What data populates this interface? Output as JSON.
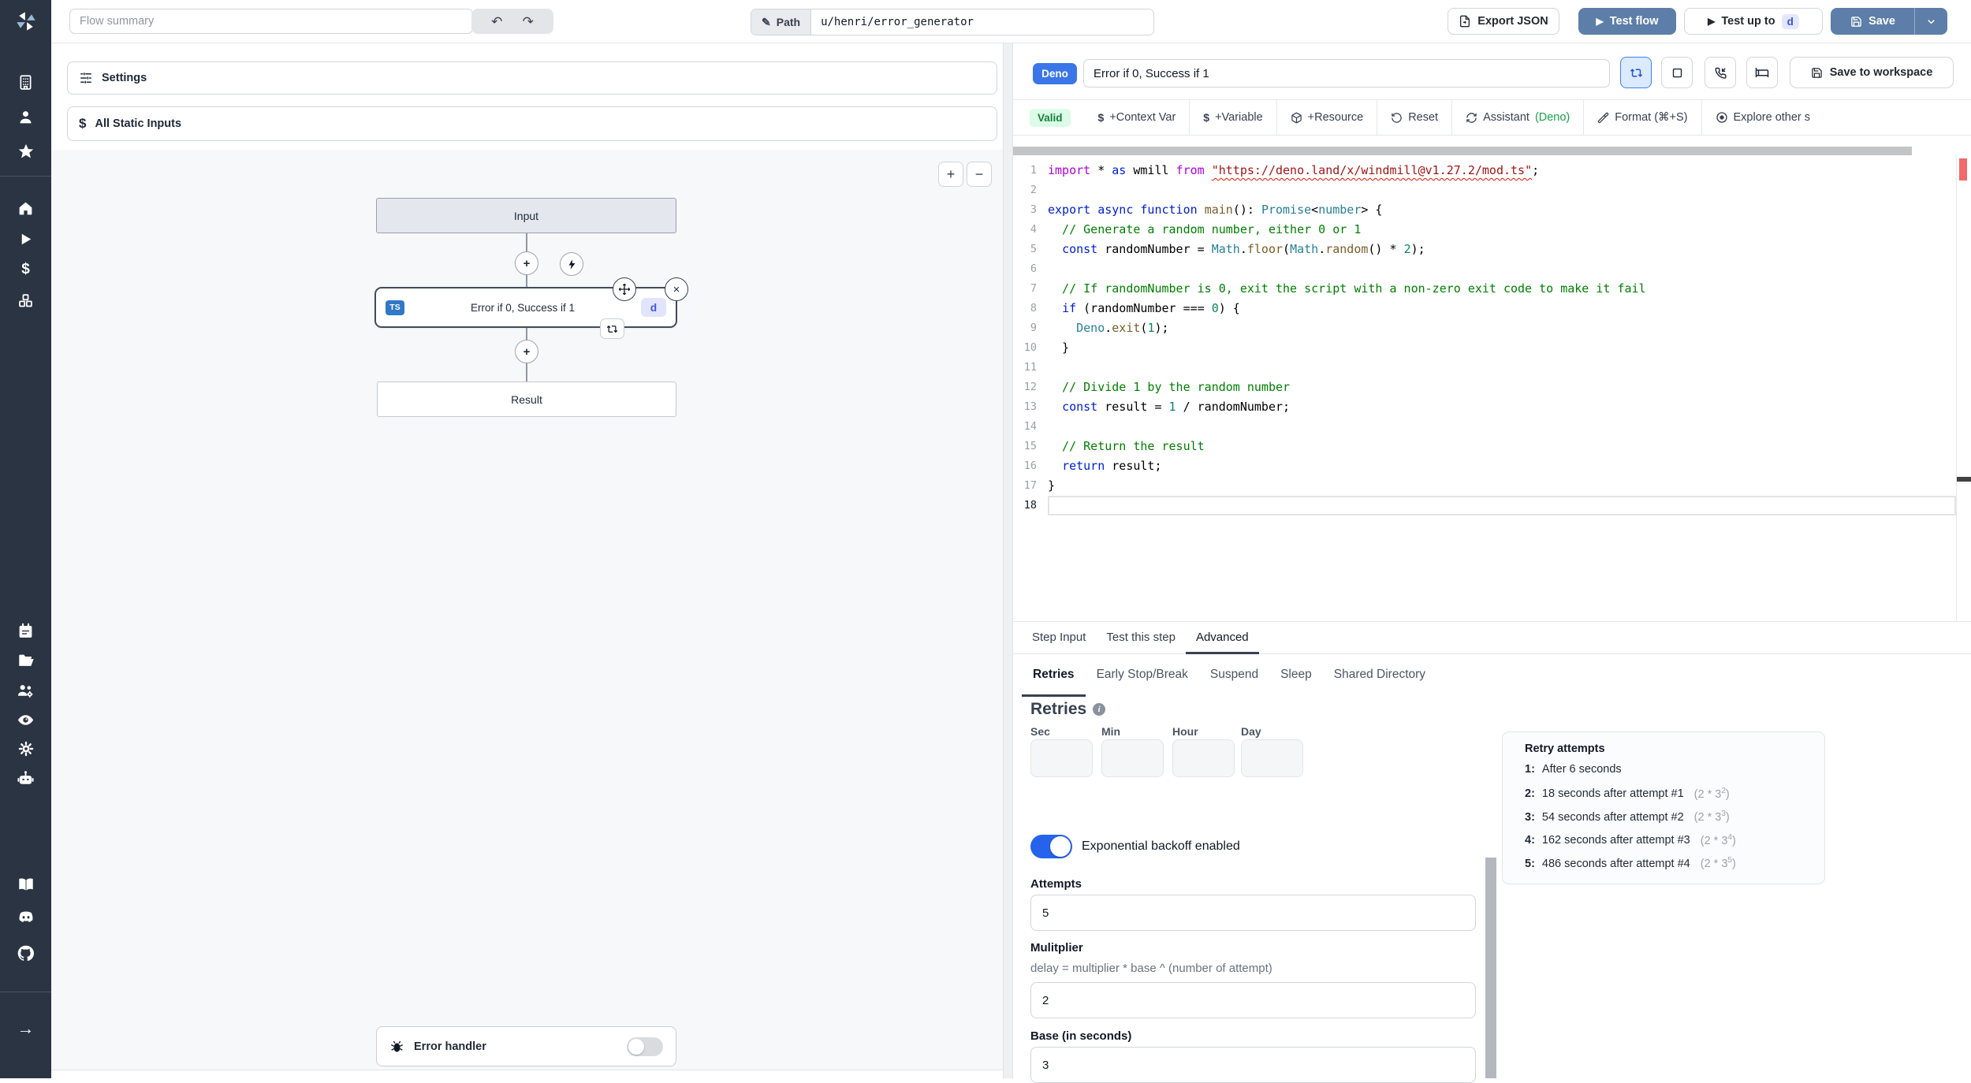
{
  "topbar": {
    "flow_summary_placeholder": "Flow summary",
    "path_label": "Path",
    "path_value": "u/henri/error_generator",
    "export_json_label": "Export JSON",
    "test_flow_label": "Test flow",
    "test_up_to_label": "Test up to",
    "test_up_to_badge": "d",
    "save_label": "Save"
  },
  "flow_panel": {
    "settings_label": "Settings",
    "static_inputs_label": "All Static Inputs",
    "zoom_in": "+",
    "zoom_out": "−",
    "nodes": {
      "input": "Input",
      "step_lang_badge": "TS",
      "step_title": "Error if 0, Success if 1",
      "step_id_badge": "d",
      "result": "Result",
      "error_handler": "Error handler"
    }
  },
  "editor": {
    "lang_badge": "Deno",
    "step_title": "Error if 0, Success if 1",
    "save_to_workspace_label": "Save to workspace",
    "toolbar": {
      "valid": "Valid",
      "context_var": "+Context Var",
      "variable": "+Variable",
      "resource": "+Resource",
      "reset": "Reset",
      "assistant": "Assistant",
      "assistant_lang": "(Deno)",
      "format": "Format (⌘+S)",
      "explore": "Explore other s"
    },
    "current_line": 18,
    "code_lines": [
      [
        [
          "m",
          "import"
        ],
        [
          "p",
          " * "
        ],
        [
          "k",
          "as"
        ],
        [
          "p",
          " wmill "
        ],
        [
          "m",
          "from"
        ],
        [
          "p",
          " "
        ],
        [
          "s",
          "\"https://deno.land/x/windmill@v1.27.2/mod.ts\""
        ],
        [
          "p",
          ";"
        ]
      ],
      [],
      [
        [
          "k",
          "export"
        ],
        [
          "p",
          " "
        ],
        [
          "k",
          "async"
        ],
        [
          "p",
          " "
        ],
        [
          "k",
          "function"
        ],
        [
          "p",
          " "
        ],
        [
          "f",
          "main"
        ],
        [
          "p",
          "(): "
        ],
        [
          "t",
          "Promise"
        ],
        [
          "p",
          "<"
        ],
        [
          "t",
          "number"
        ],
        [
          "p",
          "> {"
        ]
      ],
      [
        [
          "c",
          "  // Generate a random number, either 0 or 1"
        ]
      ],
      [
        [
          "p",
          "  "
        ],
        [
          "k",
          "const"
        ],
        [
          "p",
          " randomNumber = "
        ],
        [
          "t",
          "Math"
        ],
        [
          "p",
          "."
        ],
        [
          "f",
          "floor"
        ],
        [
          "p",
          "("
        ],
        [
          "t",
          "Math"
        ],
        [
          "p",
          "."
        ],
        [
          "f",
          "random"
        ],
        [
          "p",
          "() * "
        ],
        [
          "n",
          "2"
        ],
        [
          "p",
          ");"
        ]
      ],
      [],
      [
        [
          "c",
          "  // If randomNumber is 0, exit the script with a non-zero exit code to make it fail"
        ]
      ],
      [
        [
          "p",
          "  "
        ],
        [
          "k",
          "if"
        ],
        [
          "p",
          " (randomNumber === "
        ],
        [
          "n",
          "0"
        ],
        [
          "p",
          ") {"
        ]
      ],
      [
        [
          "p",
          "    "
        ],
        [
          "t",
          "Deno"
        ],
        [
          "p",
          "."
        ],
        [
          "f",
          "exit"
        ],
        [
          "p",
          "("
        ],
        [
          "n",
          "1"
        ],
        [
          "p",
          ");"
        ]
      ],
      [
        [
          "p",
          "  }"
        ]
      ],
      [],
      [
        [
          "c",
          "  // Divide 1 by the random number"
        ]
      ],
      [
        [
          "p",
          "  "
        ],
        [
          "k",
          "const"
        ],
        [
          "p",
          " result = "
        ],
        [
          "n",
          "1"
        ],
        [
          "p",
          " / randomNumber;"
        ]
      ],
      [],
      [
        [
          "c",
          "  // Return the result"
        ]
      ],
      [
        [
          "p",
          "  "
        ],
        [
          "k",
          "return"
        ],
        [
          "p",
          " result;"
        ]
      ],
      [
        [
          "p",
          "}"
        ]
      ],
      []
    ]
  },
  "step_tabs": {
    "tabs": [
      "Step Input",
      "Test this step",
      "Advanced"
    ],
    "active": "Advanced"
  },
  "advanced_tabs": {
    "tabs": [
      "Retries",
      "Early Stop/Break",
      "Suspend",
      "Sleep",
      "Shared Directory"
    ],
    "active": "Retries"
  },
  "retries": {
    "heading": "Retries",
    "time_labels": [
      "Sec",
      "Min",
      "Hour",
      "Day"
    ],
    "backoff_label": "Exponential backoff enabled",
    "attempts_label": "Attempts",
    "attempts_value": "5",
    "multiplier_label": "Mulitplier",
    "multiplier_desc": "delay = multiplier * base ^ (number of attempt)",
    "multiplier_value": "2",
    "base_label": "Base (in seconds)",
    "base_value": "3",
    "retry_attempts": {
      "title": "Retry attempts",
      "rows": [
        {
          "num": "1:",
          "text": "After 6 seconds",
          "formula_base": "",
          "formula_exp": ""
        },
        {
          "num": "2:",
          "text": "18 seconds after attempt #1",
          "formula_base": "2 * 3",
          "formula_exp": "2"
        },
        {
          "num": "3:",
          "text": "54 seconds after attempt #2",
          "formula_base": "2 * 3",
          "formula_exp": "3"
        },
        {
          "num": "4:",
          "text": "162 seconds after attempt #3",
          "formula_base": "2 * 3",
          "formula_exp": "4"
        },
        {
          "num": "5:",
          "text": "486 seconds after attempt #4",
          "formula_base": "2 * 3",
          "formula_exp": "5"
        }
      ]
    }
  },
  "colors": {
    "accent_blue": "#5d7ea8",
    "deno_badge_blue": "#3b76e8",
    "ts_badge_blue": "#3178c6",
    "valid_green_bg": "#dcfce7",
    "valid_green_text": "#15803d",
    "toggle_on_blue": "#2563eb",
    "sidebar_dark": "#2b3442"
  }
}
